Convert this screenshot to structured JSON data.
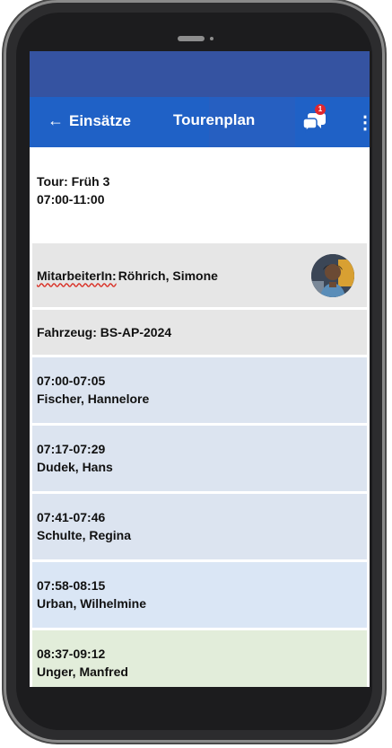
{
  "appbar": {
    "back_label": "Einsätze",
    "title": "Tourenplan",
    "badge_count": "1"
  },
  "tour": {
    "name": "Tour: Früh 3",
    "time": "07:00-11:00"
  },
  "staff": {
    "label": "MitarbeiterIn:",
    "name": "Röhrich, Simone"
  },
  "vehicle": {
    "label": "Fahrzeug: BS-AP-2024"
  },
  "visits": [
    {
      "time": "07:00-07:05",
      "name": "Fischer, Hannelore"
    },
    {
      "time": "07:17-07:29",
      "name": "Dudek, Hans"
    },
    {
      "time": "07:41-07:46",
      "name": "Schulte, Regina"
    },
    {
      "time": "07:58-08:15",
      "name": "Urban, Wilhelmine"
    },
    {
      "time": "08:37-09:12",
      "name": "Unger, Manfred"
    }
  ],
  "colors": {
    "statusbar": "#3553a1",
    "appbar": "#1f61c6",
    "badge": "#e0262e"
  }
}
